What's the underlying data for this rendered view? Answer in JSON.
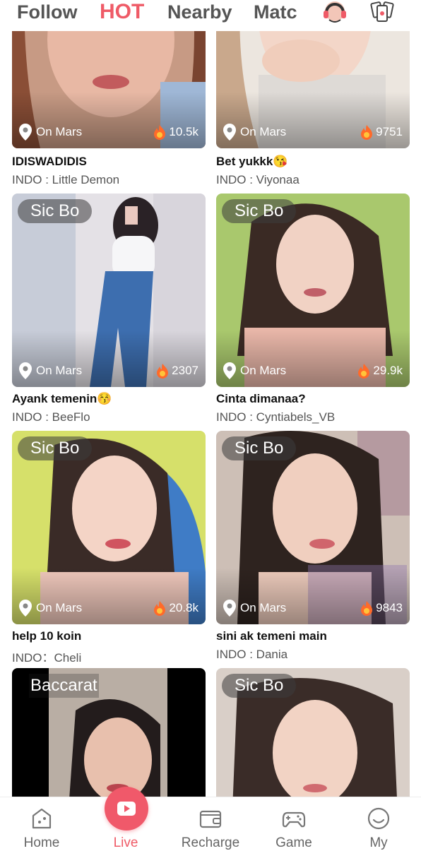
{
  "tabs": {
    "follow": "Follow",
    "hot": "HOT",
    "nearby": "Nearby",
    "match": "Matc"
  },
  "header_icons": [
    "headset-icon",
    "cards-icon"
  ],
  "rows": [
    {
      "cards": [
        {
          "badge": "",
          "location": "On Mars",
          "viewers": "10.5k",
          "title": "IDISWADIDIS",
          "host": "INDO : Little Demon"
        },
        {
          "badge": "",
          "location": "On Mars",
          "viewers": "9751",
          "title": "Bet yukkk😘",
          "host": "INDO : Viyonaa"
        }
      ]
    },
    {
      "cards": [
        {
          "badge": "Sic Bo",
          "location": "On Mars",
          "viewers": "2307",
          "title": "Ayank temenin😚",
          "host": "INDO : BeeFlo"
        },
        {
          "badge": "Sic Bo",
          "location": "On Mars",
          "viewers": "29.9k",
          "title": "Cinta dimanaa?",
          "host": "INDO : Cyntiabels_VB"
        }
      ]
    },
    {
      "cards": [
        {
          "badge": "Sic Bo",
          "location": "On Mars",
          "viewers": "20.8k",
          "title": "help 10 koin",
          "host": "INDO：Cheli"
        },
        {
          "badge": "Sic Bo",
          "location": "On Mars",
          "viewers": "9843",
          "title": "sini ak temeni main",
          "host": "INDO : Dania"
        }
      ]
    },
    {
      "cards": [
        {
          "badge": "Baccarat"
        },
        {
          "badge": "Sic Bo"
        }
      ]
    }
  ],
  "bottom_nav": {
    "home": "Home",
    "live": "Live",
    "recharge": "Recharge",
    "game": "Game",
    "my": "My"
  },
  "colors": {
    "accent": "#ef5b67",
    "text": "#111111",
    "muted": "#555555"
  }
}
